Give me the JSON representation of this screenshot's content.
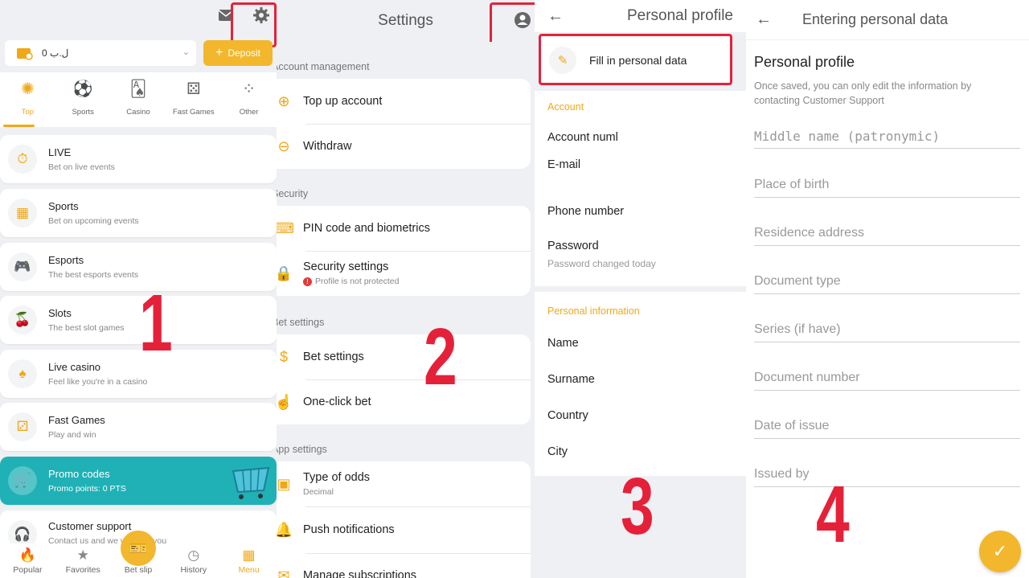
{
  "panel1": {
    "balance": {
      "value": "0 ل.ب"
    },
    "deposit_label": "Deposit",
    "categories": [
      {
        "label": "Top",
        "icon": "star-burst-icon"
      },
      {
        "label": "Sports",
        "icon": "ball-icon"
      },
      {
        "label": "Casino",
        "icon": "cards-icon"
      },
      {
        "label": "Fast Games",
        "icon": "dice-icon"
      },
      {
        "label": "Other",
        "icon": "dots-icon"
      }
    ],
    "menu": [
      {
        "title": "LIVE",
        "subtitle": "Bet on live events",
        "icon": "stopwatch-icon"
      },
      {
        "title": "Sports",
        "subtitle": "Bet on upcoming events",
        "icon": "calendar-icon"
      },
      {
        "title": "Esports",
        "subtitle": "The best esports events",
        "icon": "gamepad-icon"
      },
      {
        "title": "Slots",
        "subtitle": "The best slot games",
        "icon": "cherries-icon"
      },
      {
        "title": "Live casino",
        "subtitle": "Feel like you're in a casino",
        "icon": "spade-icon"
      },
      {
        "title": "Fast Games",
        "subtitle": "Play and win",
        "icon": "dice-icon"
      },
      {
        "title": "Promo codes",
        "subtitle": "Promo points: 0 PTS",
        "icon": "cart-icon"
      },
      {
        "title": "Customer support",
        "subtitle": "Contact us and we will help you",
        "icon": "headset-icon"
      }
    ],
    "bottom_nav": [
      {
        "label": "Popular",
        "icon": "flame-icon"
      },
      {
        "label": "Favorites",
        "icon": "star-icon"
      },
      {
        "label": "Bet slip",
        "icon": "ticket-icon"
      },
      {
        "label": "History",
        "icon": "clock-icon"
      },
      {
        "label": "Menu",
        "icon": "grid-icon"
      }
    ],
    "step_number": "1"
  },
  "panel2": {
    "title": "Settings",
    "sections": [
      {
        "label": "Account management",
        "rows": [
          {
            "title": "Top up account"
          },
          {
            "title": "Withdraw"
          }
        ]
      },
      {
        "label": "Security",
        "rows": [
          {
            "title": "PIN code and biometrics"
          },
          {
            "title": "Security settings",
            "subtitle": "Profile is not protected"
          }
        ]
      },
      {
        "label": "Bet settings",
        "rows": [
          {
            "title": "Bet settings"
          },
          {
            "title": "One-click bet"
          }
        ]
      },
      {
        "label": "App settings",
        "rows": [
          {
            "title": "Type of odds",
            "subtitle": "Decimal"
          },
          {
            "title": "Push notifications"
          },
          {
            "title": "Manage subscriptions"
          }
        ]
      }
    ],
    "step_number": "2"
  },
  "panel3": {
    "title": "Personal profile",
    "fill_label": "Fill in personal data",
    "account_section": "Account",
    "account_rows": [
      "Account numl",
      "E-mail",
      "Phone number",
      "Password"
    ],
    "password_note": "Password changed today",
    "personal_section": "Personal information",
    "personal_rows": [
      "Name",
      "Surname",
      "Country",
      "City"
    ],
    "step_number": "3"
  },
  "panel4": {
    "title": "Entering personal data",
    "heading": "Personal profile",
    "note": "Once saved, you can only edit the information by contacting Customer Support",
    "fields": [
      "Middle name (patronymic)",
      "Place of birth",
      "Residence address",
      "Document type",
      "Series (if have)",
      "Document number",
      "Date of issue",
      "Issued by"
    ],
    "step_number": "4"
  },
  "colors": {
    "accent": "#f0a818",
    "promo": "#1fb1b6",
    "highlight": "#e5213a"
  }
}
